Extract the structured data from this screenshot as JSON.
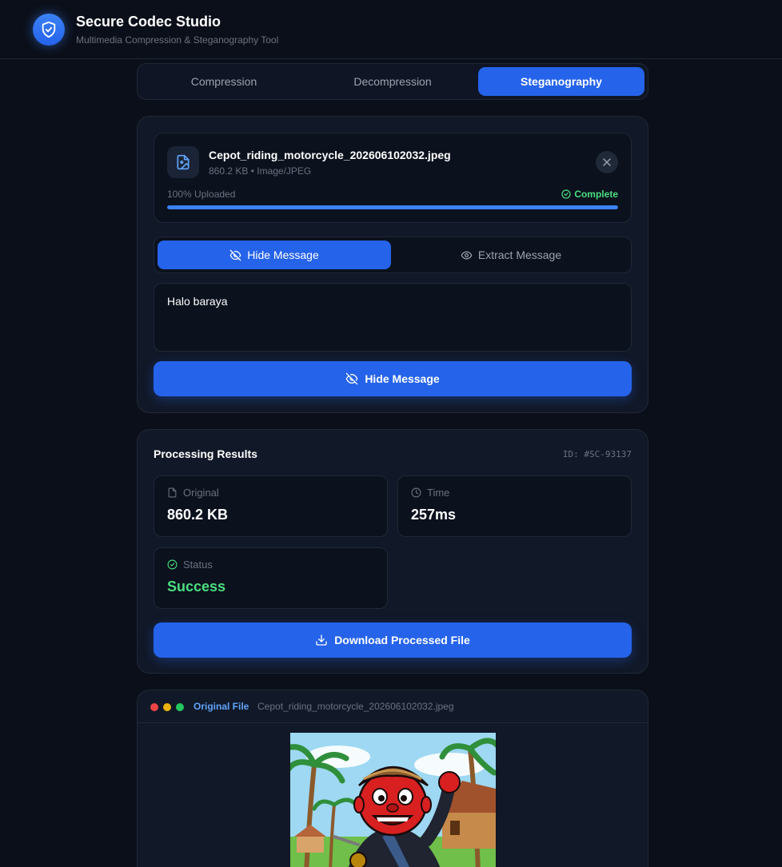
{
  "app": {
    "title": "Secure Codec Studio",
    "subtitle": "Multimedia Compression & Steganography Tool",
    "logo_icon": "shield-check-icon"
  },
  "tabs": [
    {
      "label": "Compression",
      "active": false
    },
    {
      "label": "Decompression",
      "active": false
    },
    {
      "label": "Steganography",
      "active": true
    }
  ],
  "upload": {
    "file_name": "Cepot_riding_motorcycle_202606102032.jpeg",
    "file_meta": "860.2 KB • Image/JPEG",
    "progress_label": "100% Uploaded",
    "progress_percent": 100,
    "status": "Complete"
  },
  "mode": {
    "hide_label": "Hide Message",
    "extract_label": "Extract Message",
    "selected": "hide"
  },
  "message": {
    "value": "Halo baraya"
  },
  "action": {
    "hide_button": "Hide Message"
  },
  "results": {
    "title": "Processing Results",
    "id": "ID: #SC-93137",
    "original_label": "Original",
    "original_value": "860.2 KB",
    "time_label": "Time",
    "time_value": "257ms",
    "status_label": "Status",
    "status_value": "Success",
    "download_button": "Download Processed File"
  },
  "preview": {
    "label": "Original File",
    "file_name": "Cepot_riding_motorcycle_202606102032.jpeg"
  },
  "colors": {
    "accent": "#2563eb",
    "success": "#4ade80",
    "background": "#0b0f19",
    "card": "#111827"
  }
}
